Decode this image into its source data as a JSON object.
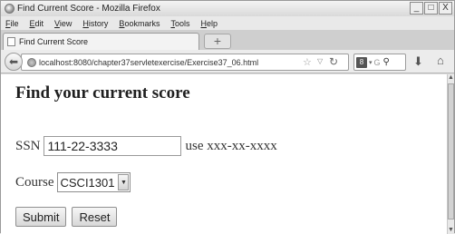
{
  "window": {
    "title": "Find Current Score - Mozilla Firefox",
    "controls": {
      "minimize": "_",
      "maximize": "□",
      "close": "X"
    }
  },
  "menu": [
    {
      "accel": "F",
      "rest": "ile"
    },
    {
      "accel": "E",
      "rest": "dit"
    },
    {
      "accel": "V",
      "rest": "iew"
    },
    {
      "accel": "H",
      "rest": "istory"
    },
    {
      "accel": "B",
      "rest": "ookmarks"
    },
    {
      "accel": "T",
      "rest": "ools"
    },
    {
      "accel": "H",
      "rest": "elp"
    }
  ],
  "tab": {
    "label": "Find Current Score",
    "new_tab_symbol": "+"
  },
  "navbar": {
    "url": "localhost:8080/chapter37servletexercise/Exercise37_06.html",
    "search_hint": "G",
    "search_engine_label": "8"
  },
  "icons": {
    "back": "back-arrow-icon",
    "site": "globe-icon",
    "bookmark": "star-icon",
    "reload": "reload-icon",
    "search": "magnifier-icon",
    "download": "download-icon",
    "home": "home-icon"
  },
  "page": {
    "heading": "Find your current score",
    "ssn_label": "SSN",
    "ssn_value": "111-22-3333",
    "ssn_hint": "use xxx-xx-xxxx",
    "course_label": "Course",
    "course_selected": "CSCI1301",
    "submit_label": "Submit",
    "reset_label": "Reset"
  }
}
